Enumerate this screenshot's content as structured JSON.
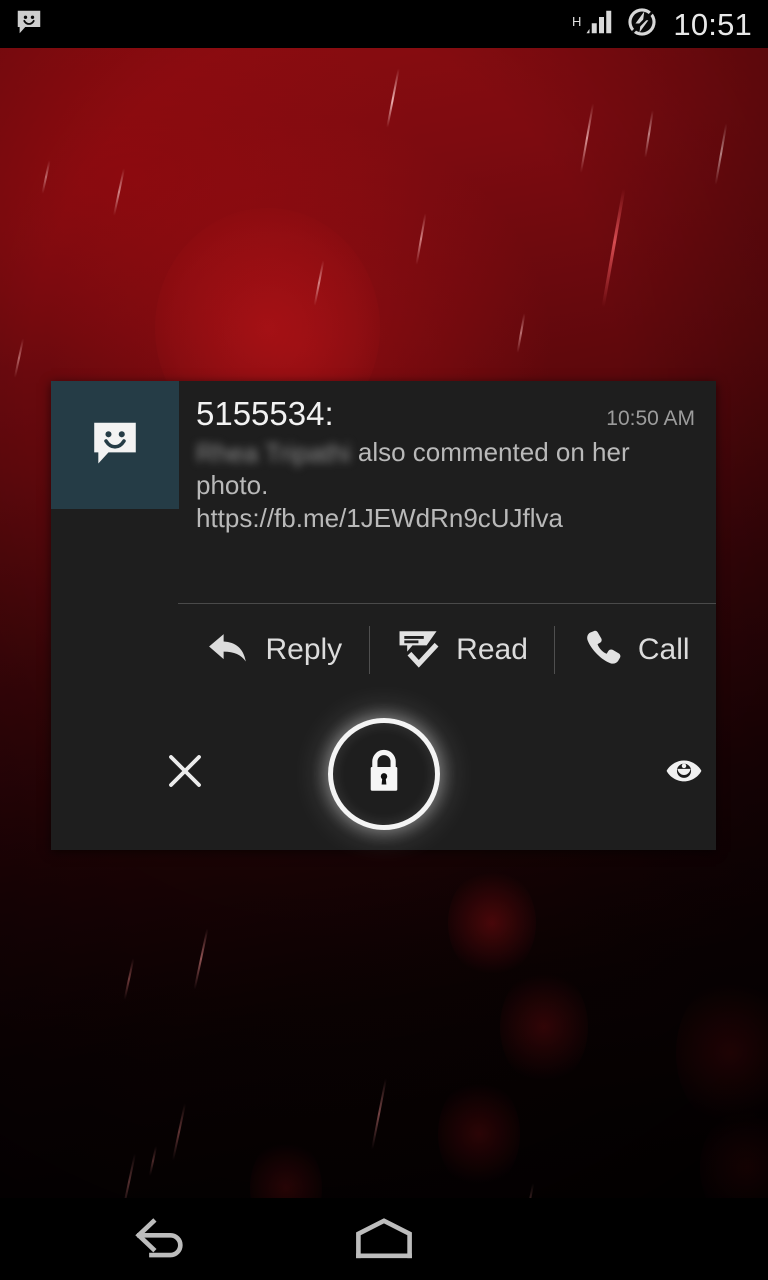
{
  "status_bar": {
    "notification_icon": "message-smiley-icon",
    "network_type": "H",
    "signal_icon": "signal-bars-icon",
    "battery_icon": "battery-charging-icon",
    "clock": "10:51"
  },
  "notification": {
    "app_icon": "message-smiley-icon",
    "sender": "5155534:",
    "time": "10:50 AM",
    "redacted_name": "Rhea Tripathi",
    "message": "also commented on her photo.",
    "url": "https://fb.me/1JEWdRn9cUJflva",
    "actions": [
      {
        "label": "Reply",
        "icon": "reply-arrow-icon"
      },
      {
        "label": "Read",
        "icon": "mark-read-icon"
      },
      {
        "label": "Call",
        "icon": "phone-icon"
      }
    ]
  },
  "controls": {
    "dismiss_icon": "close-x-icon",
    "unlock_icon": "lock-icon",
    "peek_icon": "eye-icon"
  },
  "nav_bar": {
    "back_icon": "back-arrow-icon",
    "home_icon": "home-icon"
  },
  "colors": {
    "wallpaper_red": "#8c0c10",
    "card_background": "#1e1e1e",
    "app_icon_tile": "#253c46",
    "accent_text": "#f2f2f2",
    "secondary_text": "#b9b9b9",
    "muted_text": "#9c9c9c"
  }
}
